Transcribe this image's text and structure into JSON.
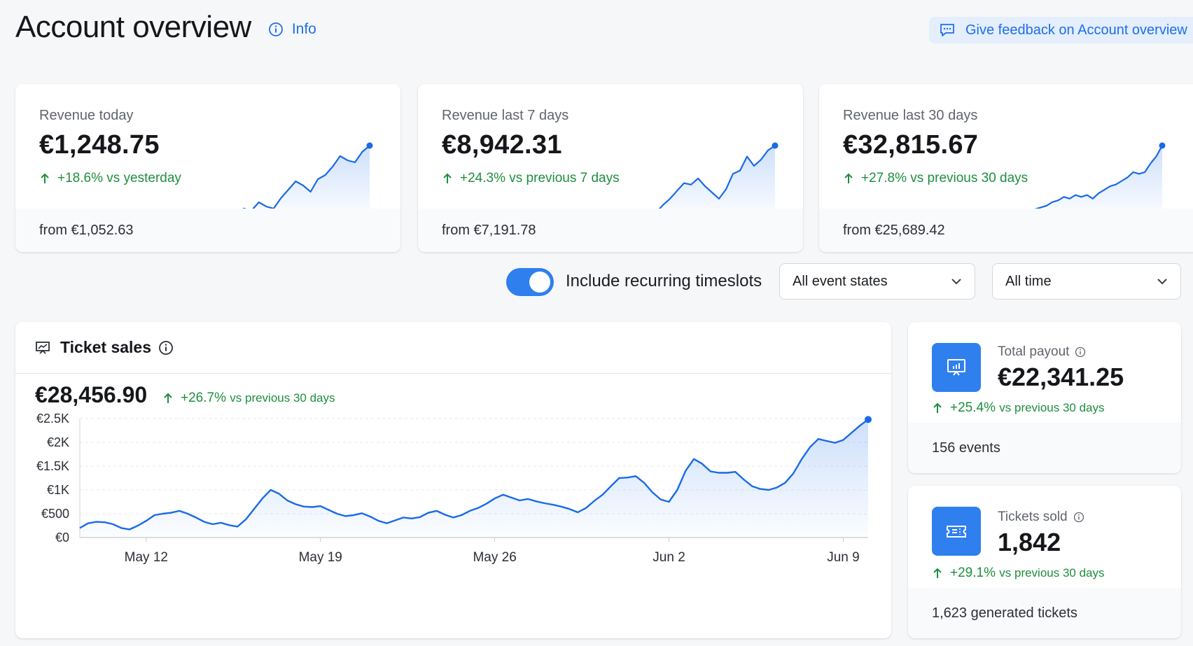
{
  "header": {
    "title": "Account overview",
    "info_label": "Info",
    "feedback_label": "Give feedback on Account overview"
  },
  "revenue_cards": [
    {
      "label": "Revenue today",
      "value": "€1,248.75",
      "change": "+18.6%",
      "comparison": "vs yesterday",
      "footer": "from €1,052.63",
      "trend": [
        6,
        8,
        7,
        11,
        9,
        8,
        13,
        17,
        21,
        19,
        16,
        22,
        24,
        28,
        33,
        31,
        30,
        35,
        38
      ]
    },
    {
      "label": "Revenue last 7 days",
      "value": "€8,942.31",
      "change": "+24.3%",
      "comparison": "vs previous 7 days",
      "footer": "from €7,191.78",
      "trend": [
        5,
        6,
        5,
        10,
        14,
        19,
        24,
        23,
        27,
        22,
        18,
        14,
        20,
        30,
        32,
        41,
        35,
        39,
        45,
        48
      ]
    },
    {
      "label": "Revenue last 30 days",
      "value": "€32,815.67",
      "change": "+27.8%",
      "comparison": "vs previous 30 days",
      "footer": "from €25,689.42",
      "trend": [
        2,
        4,
        5,
        6,
        8,
        9,
        11,
        10,
        12,
        11,
        12,
        10,
        13,
        15,
        17,
        18,
        20,
        22,
        25,
        24,
        25,
        30,
        34,
        40
      ]
    }
  ],
  "filters": {
    "toggle_label": "Include recurring timeslots",
    "toggle_on": true,
    "event_state": "All event states",
    "time_range": "All time"
  },
  "ticket_sales": {
    "title": "Ticket sales",
    "total": "€28,456.90",
    "change": "+26.7%",
    "comparison": "vs previous 30 days"
  },
  "chart_data": {
    "type": "area",
    "yticks": [
      "€2.5K",
      "€2K",
      "€1.5K",
      "€1K",
      "€500",
      "€0"
    ],
    "xticks": [
      "May 12",
      "May 19",
      "May 26",
      "Jun 2",
      "Jun 9"
    ],
    "ylim": [
      0,
      2500
    ],
    "x": [
      0,
      1,
      2,
      3,
      4,
      5,
      6,
      7,
      8,
      9,
      10,
      11,
      12,
      13,
      14,
      15,
      16,
      17,
      18,
      19,
      20,
      21,
      22,
      23,
      24,
      25,
      26,
      27,
      28,
      29,
      30,
      31,
      32,
      33,
      34,
      35,
      36,
      37,
      38,
      39,
      40,
      41,
      42,
      43,
      44,
      45,
      46,
      47,
      48,
      49,
      50,
      51,
      52,
      53,
      54,
      55,
      56,
      57,
      58,
      59,
      60,
      61,
      62,
      63,
      64,
      65,
      66,
      67,
      68,
      69,
      70,
      71,
      72,
      73,
      74,
      75,
      76,
      77,
      78,
      79,
      80,
      81,
      82,
      83
    ],
    "values": [
      200,
      300,
      330,
      320,
      280,
      200,
      170,
      250,
      350,
      470,
      500,
      520,
      560,
      500,
      420,
      330,
      280,
      310,
      260,
      230,
      380,
      600,
      820,
      1000,
      920,
      780,
      700,
      650,
      640,
      660,
      580,
      500,
      450,
      470,
      510,
      440,
      350,
      300,
      360,
      420,
      400,
      430,
      520,
      560,
      480,
      420,
      470,
      560,
      620,
      710,
      820,
      900,
      840,
      780,
      810,
      760,
      720,
      690,
      650,
      600,
      530,
      620,
      770,
      900,
      1080,
      1250,
      1260,
      1290,
      1150,
      950,
      800,
      750,
      1000,
      1400,
      1650,
      1550,
      1390,
      1360,
      1360,
      1380,
      1220,
      1080,
      1020,
      1000
    ],
    "values_tail": [
      1050,
      1150,
      1350,
      1650,
      1900,
      2070,
      2030,
      1990,
      2050,
      2200,
      2350,
      2480
    ],
    "title": "",
    "xlabel": "",
    "ylabel": "",
    "grid": true
  },
  "payout_card": {
    "label": "Total payout",
    "value": "€22,341.25",
    "change": "+25.4%",
    "comparison": "vs previous 30 days",
    "footer": "156 events"
  },
  "tickets_card": {
    "label": "Tickets sold",
    "value": "1,842",
    "change": "+29.1%",
    "comparison": "vs previous 30 days",
    "footer": "1,623 generated tickets"
  },
  "colors": {
    "accent": "#1f6feb",
    "positive": "#1e8e3e",
    "line": "#1a6ae6"
  }
}
